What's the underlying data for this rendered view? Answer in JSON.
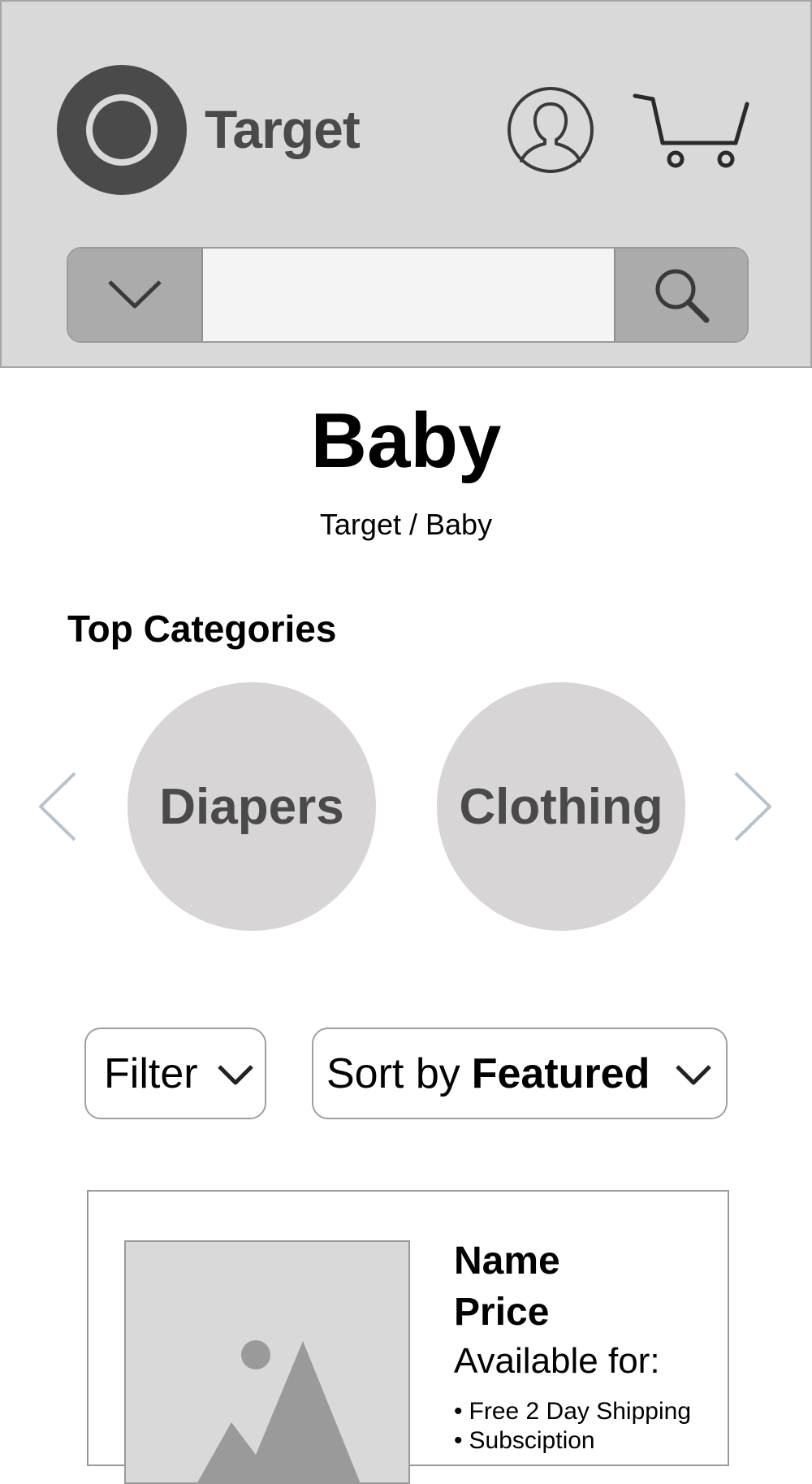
{
  "header": {
    "brand_name": "Target",
    "search": {
      "placeholder": "",
      "value": ""
    }
  },
  "page": {
    "title": "Baby",
    "breadcrumb": [
      "Target",
      "Baby"
    ],
    "breadcrumb_separator": "/"
  },
  "top_categories": {
    "heading": "Top Categories",
    "items": [
      {
        "label": "Diapers"
      },
      {
        "label": "Clothing"
      }
    ]
  },
  "toolbar": {
    "filter_label": "Filter",
    "sort_prefix": "Sort by",
    "sort_value": "Featured"
  },
  "products": [
    {
      "name": "Name",
      "price": "Price",
      "available_label": "Available for:",
      "benefits": [
        "Free 2 Day Shipping",
        "Subsciption"
      ]
    }
  ],
  "colors": {
    "header_bg": "#d9d9d9",
    "logo": "#4a4a4a",
    "category_bg": "#d7d5d6",
    "arrow": "#b8c2cc",
    "search_button_bg": "#ababab"
  },
  "icons": {
    "logo": "bullseye-logo-icon",
    "account": "account-icon",
    "cart": "cart-icon",
    "dropdown": "chevron-down-icon",
    "search": "search-icon",
    "prev": "chevron-left-icon",
    "next": "chevron-right-icon",
    "image_placeholder": "image-placeholder-icon"
  }
}
